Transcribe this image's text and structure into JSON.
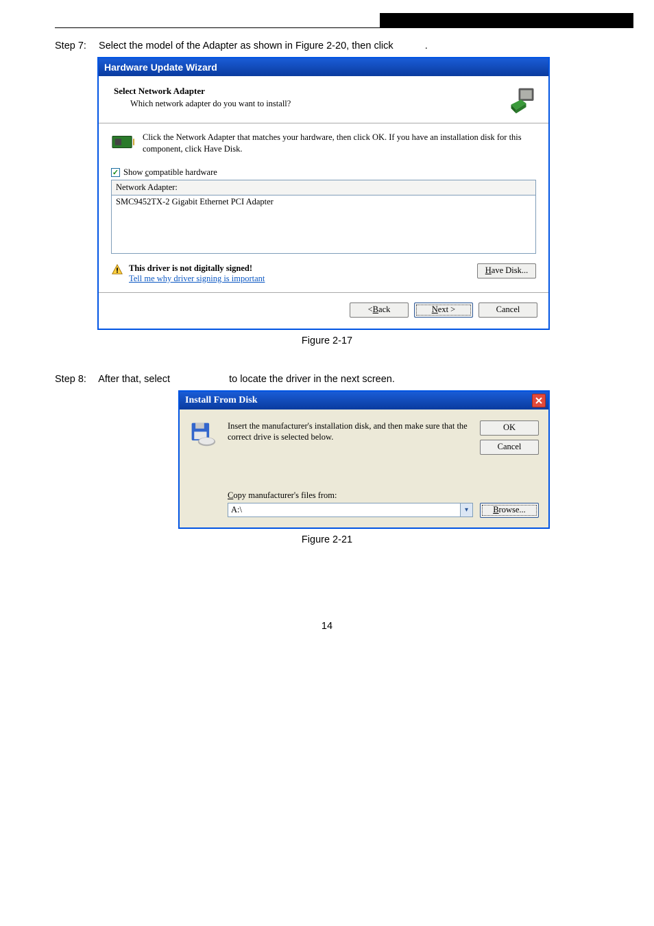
{
  "steps": {
    "s7": {
      "label": "Step 7:",
      "text": "Select the model of the Adapter as shown in Figure   2-20, then click",
      "trail": "."
    },
    "s8": {
      "label": "Step 8:",
      "lead": "After that, select",
      "tail": "to locate the driver in the next screen."
    }
  },
  "wizard": {
    "title": "Hardware Update Wizard",
    "h1": "Select Network Adapter",
    "h2": "Which network adapter do you want to install?",
    "info": "Click the Network Adapter that matches your hardware, then click OK. If you have an installation disk for this component, click Have Disk.",
    "cb_label_pre": "Show ",
    "cb_label_u": "c",
    "cb_label_post": "ompatible hardware",
    "list_header": "Network Adapter:",
    "list_item": "SMC9452TX-2 Gigabit Ethernet PCI Adapter",
    "warn_title": "This driver is not digitally signed!",
    "warn_link": "Tell me why driver signing is important",
    "btn_have_pre": "H",
    "btn_have_post": "ave Disk...",
    "btn_back_pre": "< ",
    "btn_back_u": "B",
    "btn_back_post": "ack",
    "btn_next_u": "N",
    "btn_next_post": "ext >",
    "btn_cancel": "Cancel"
  },
  "captions": {
    "fig1": "Figure 2-17",
    "fig2": "Figure 2-21"
  },
  "dialog": {
    "title": "Install From Disk",
    "msg": "Insert the manufacturer's installation disk, and then make sure that the correct drive is selected below.",
    "btn_ok": "OK",
    "btn_cancel": "Cancel",
    "copy_u": "C",
    "copy_post": "opy manufacturer's files from:",
    "path": "A:\\",
    "btn_browse_u": "B",
    "btn_browse_post": "rowse..."
  },
  "page_num": "14"
}
